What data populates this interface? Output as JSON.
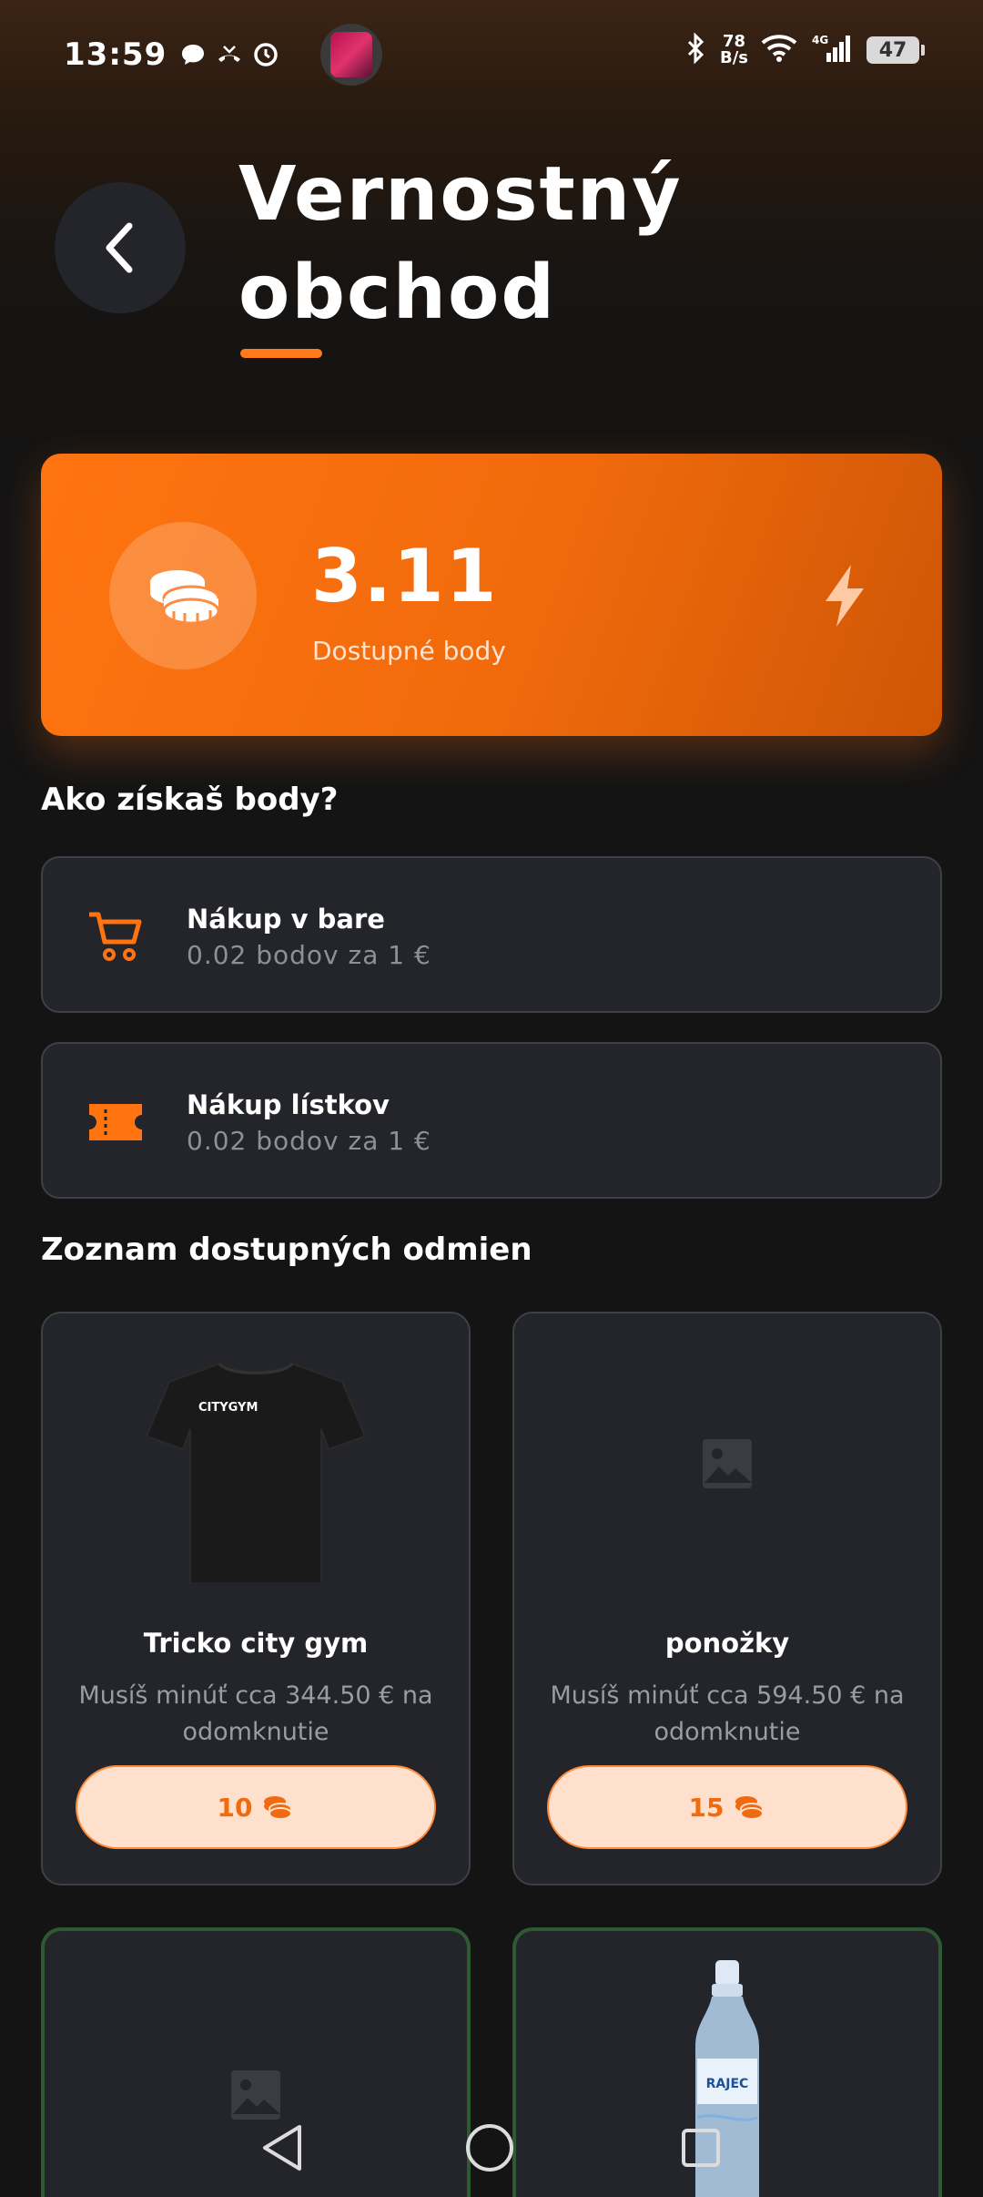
{
  "status_bar": {
    "time": "13:59",
    "net_speed_value": "78",
    "net_speed_unit": "B/s",
    "battery": "47",
    "left_icons": [
      "chat-icon",
      "missed-call-icon",
      "alarm-icon"
    ],
    "right_icons": [
      "bluetooth-icon",
      "wifi-icon",
      "signal-4g-icon"
    ]
  },
  "header": {
    "title_line1": "Vernostný",
    "title_line2": "obchod"
  },
  "points": {
    "value": "3.11",
    "label": "Dostupné body"
  },
  "earn": {
    "title": "Ako získaš body?",
    "items": [
      {
        "icon": "cart-icon",
        "title": "Nákup v bare",
        "subtitle": "0.02 bodov za 1 €"
      },
      {
        "icon": "ticket-icon",
        "title": "Nákup lístkov",
        "subtitle": "0.02 bodov za 1 €"
      }
    ]
  },
  "rewards": {
    "title": "Zoznam dostupných odmien",
    "items": [
      {
        "name": "Tricko city gym",
        "desc": "Musíš minúť cca 344.50 € na odomknutie",
        "cost": "10",
        "image": "tshirt",
        "brand_text": "CITYGYM"
      },
      {
        "name": "ponožky",
        "desc": "Musíš minúť cca 594.50 € na odomknutie",
        "cost": "15",
        "image": "placeholder"
      },
      {
        "image": "placeholder",
        "unlocked": true
      },
      {
        "image": "water-bottle",
        "unlocked": true,
        "brand_text": "RAJEC"
      }
    ]
  },
  "colors": {
    "accent": "#ff7410",
    "background": "#141414",
    "card": "#23252a",
    "unlocked_border": "#2e5a33"
  }
}
